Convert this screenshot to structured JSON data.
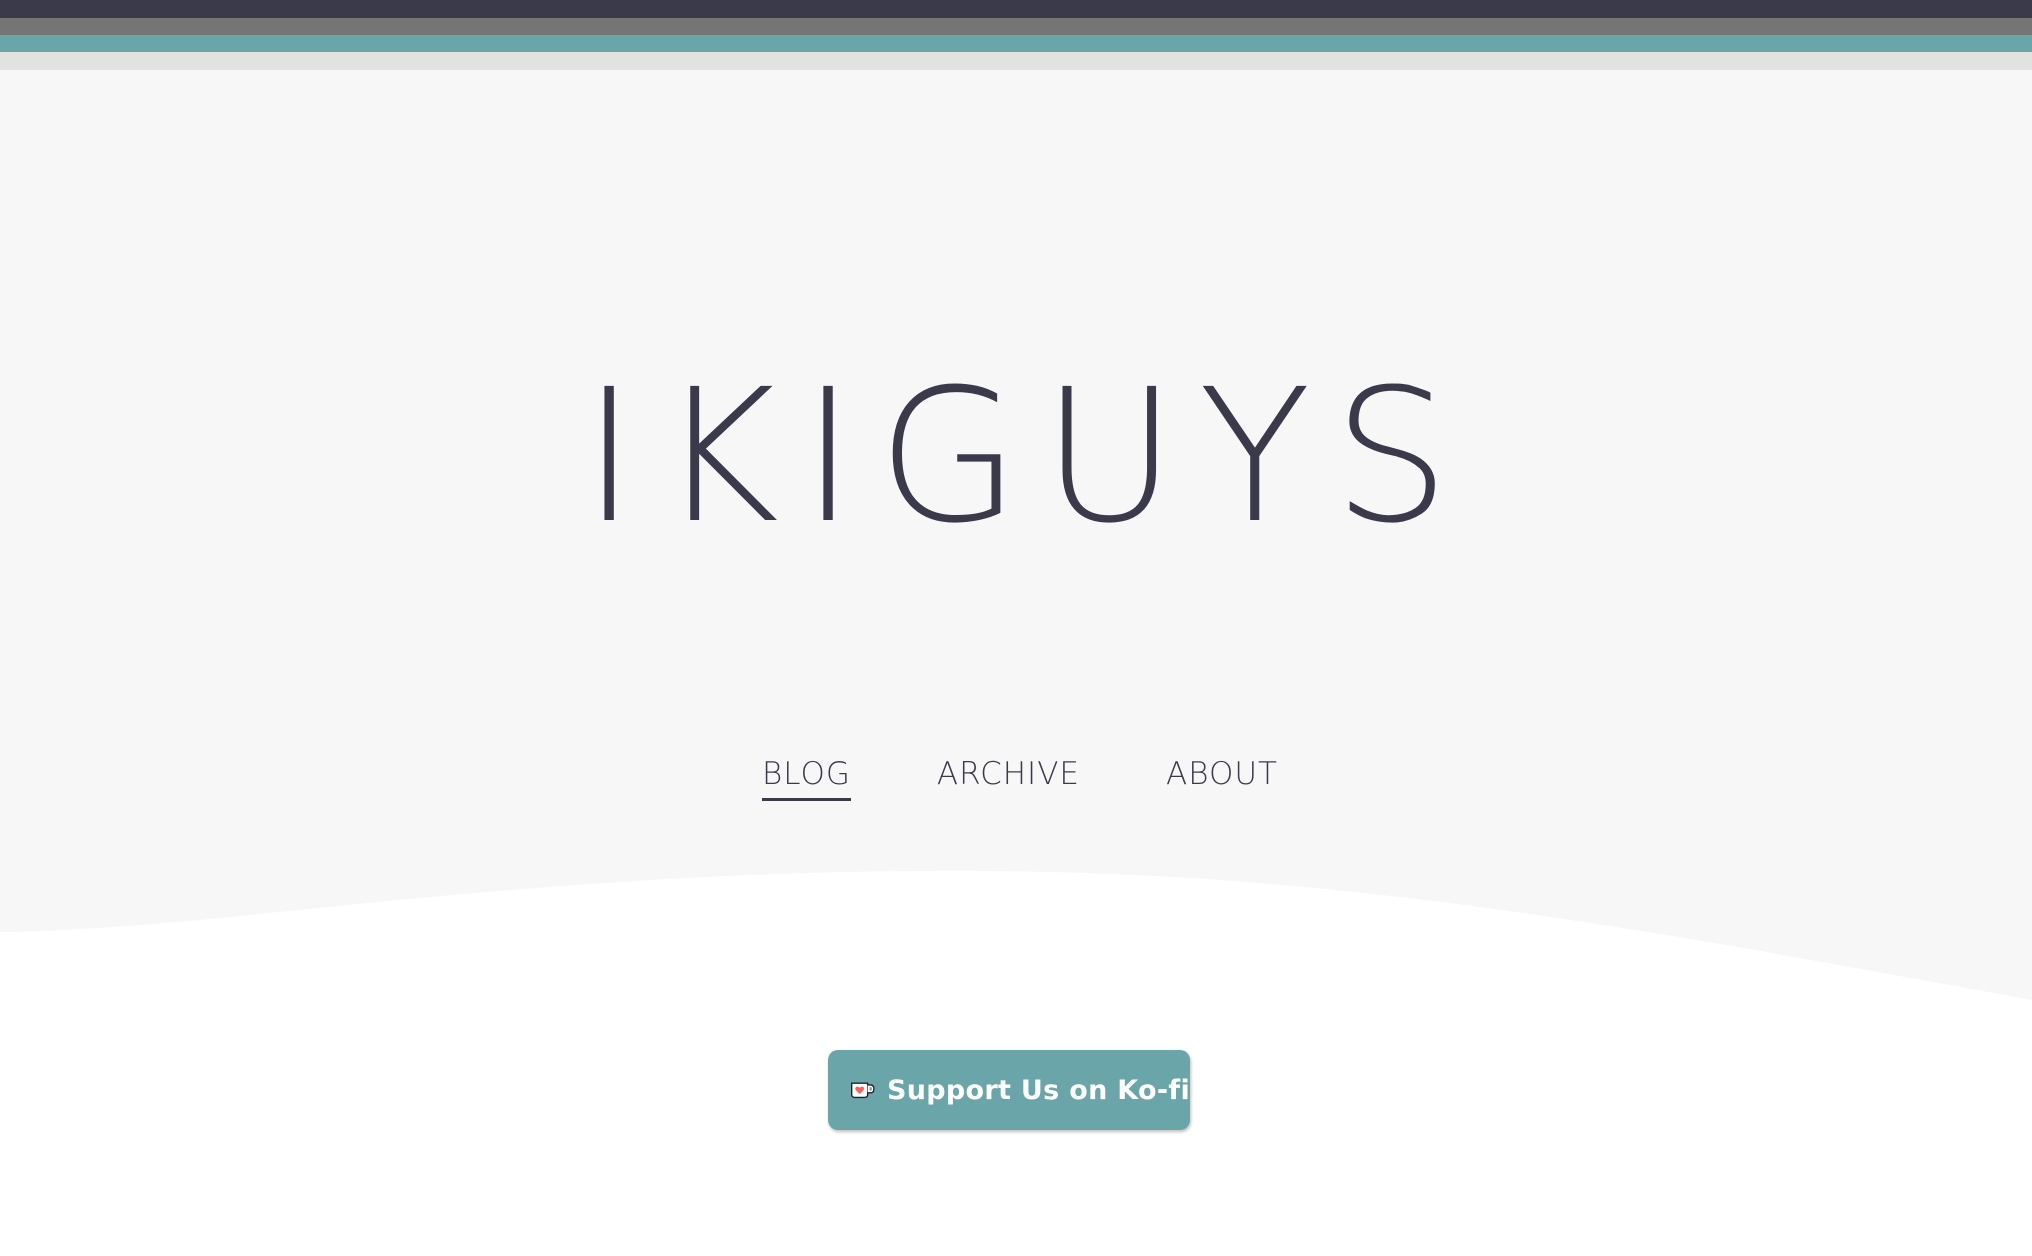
{
  "colors": {
    "stripe_dark": "#3b3a4b",
    "stripe_gray": "#757575",
    "stripe_teal": "#6aa6a9",
    "stripe_light": "#e1e3e1",
    "hero_background": "#f7f7f7",
    "text_dark": "#3b3a4b",
    "kofi_button": "#6aa6a9",
    "kofi_heart": "#ff5e5b"
  },
  "header": {
    "title": "IKIGUYS"
  },
  "nav": {
    "items": [
      {
        "label": "BLOG",
        "active": true
      },
      {
        "label": "ARCHIVE",
        "active": false
      },
      {
        "label": "ABOUT",
        "active": false
      }
    ]
  },
  "support": {
    "label": "Support Us on Ko-fi",
    "icon": "kofi-cup-icon"
  }
}
